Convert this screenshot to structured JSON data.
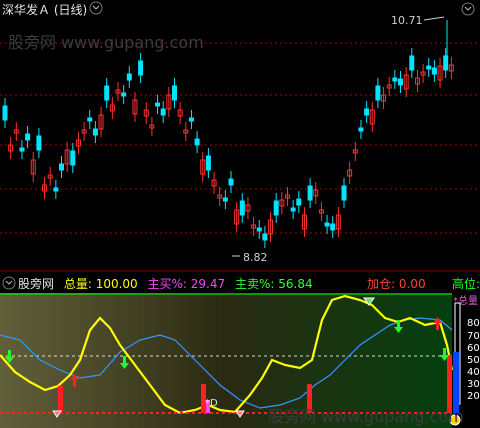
{
  "window": {
    "title": "深华发Ａ (日线)"
  },
  "watermark": {
    "top": "股旁网 www.gupang.com",
    "bottom": "股旁网 www.gupang.com"
  },
  "price_chart": {
    "max_label": "10.71",
    "min_label": "8.82",
    "colors": {
      "up": "#ff3030",
      "down": "#00e5ff",
      "grid": "#aa0000"
    }
  },
  "indicator": {
    "name": "股旁网",
    "total": "总量: 100.00",
    "main_buy": "主买%: 29.47",
    "main_sell": "主卖%: 56.84",
    "add_position": "加仓: 0.00",
    "high_position": "高位:",
    "legend_label": "*总量",
    "d_marker": "*D",
    "ticks": [
      "80",
      "70",
      "60",
      "50",
      "40",
      "30",
      "20"
    ],
    "colors": {
      "total": "#ffff00",
      "buy": "#ff44ff",
      "sell": "#33ff33",
      "blue_line": "#3399ff"
    }
  }
}
